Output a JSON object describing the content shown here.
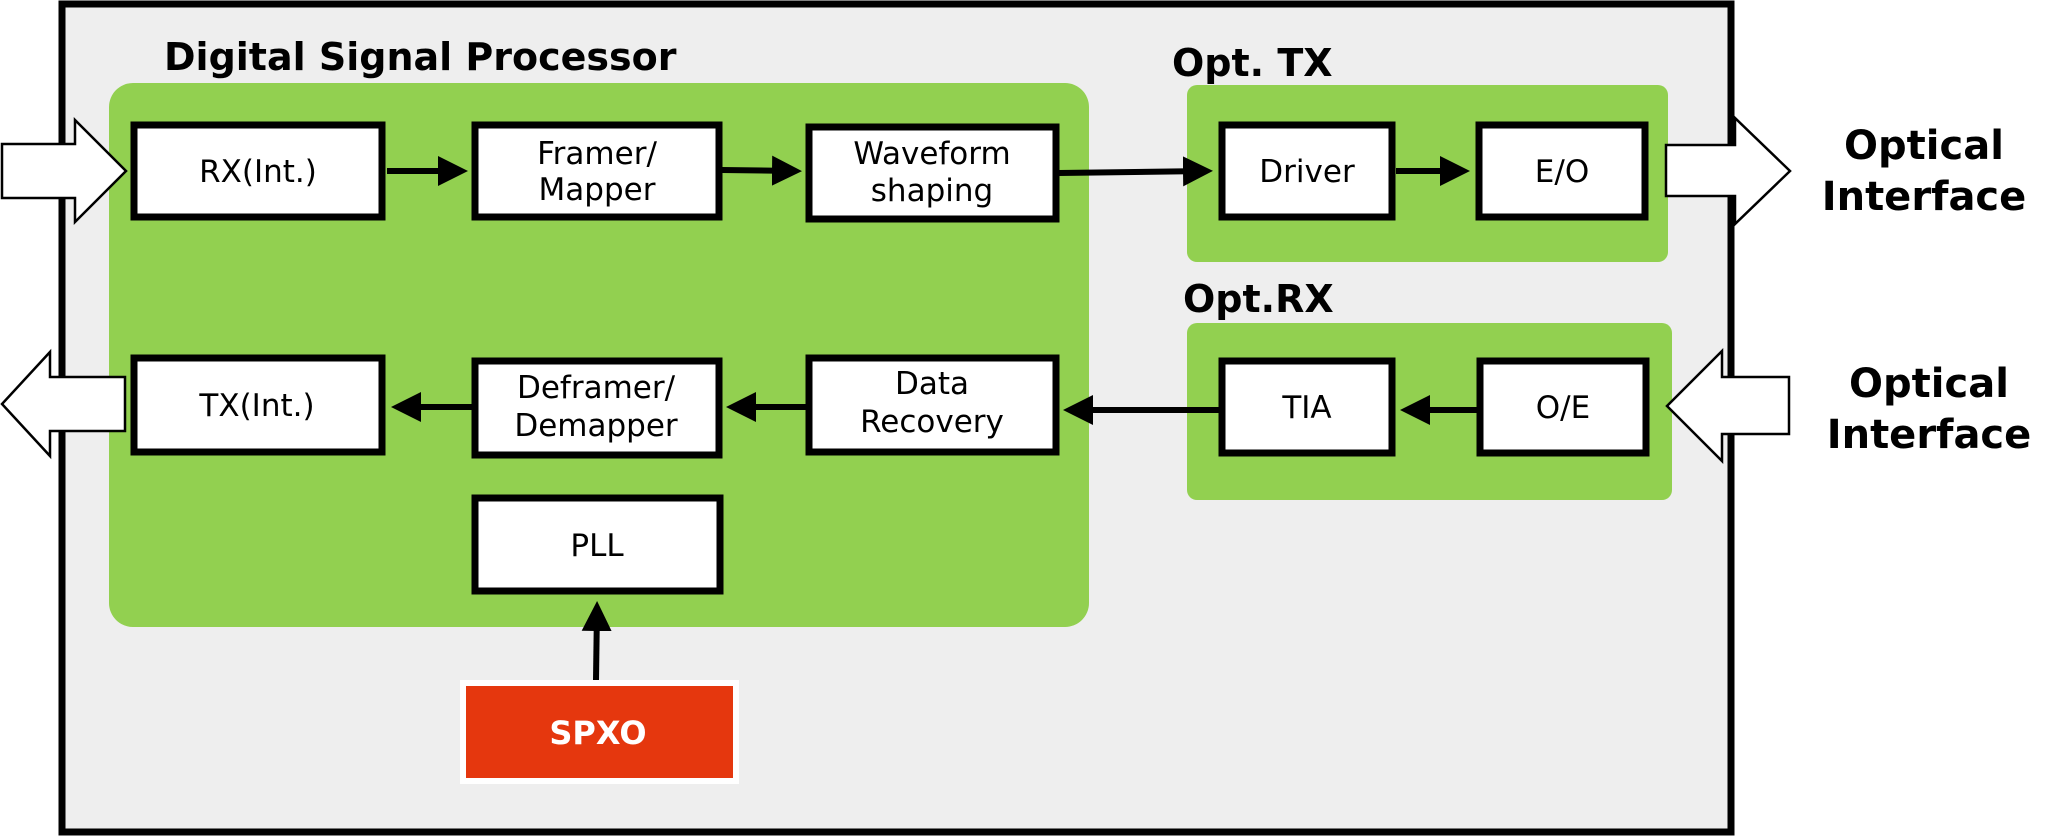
{
  "colors": {
    "background": "#EEEEEE",
    "group_fill": "#92D050",
    "oscillator_fill": "#E5370E",
    "border": "#000000"
  },
  "groups": {
    "dsp": {
      "title": "Digital Signal Processor"
    },
    "opt_tx": {
      "title": "Opt. TX"
    },
    "opt_rx": {
      "title": "Opt.RX"
    }
  },
  "blocks": {
    "rx_int": [
      "RX(Int.)"
    ],
    "framer": [
      "Framer/",
      "Mapper"
    ],
    "waveform": [
      "Waveform",
      "shaping"
    ],
    "tx_int": [
      "TX(Int.)"
    ],
    "deframer": [
      "Deframer/",
      "Demapper"
    ],
    "data_recovery": [
      "Data",
      "Recovery"
    ],
    "pll": [
      "PLL"
    ],
    "driver": [
      "Driver"
    ],
    "eo": [
      "E/O"
    ],
    "tia": [
      "TIA"
    ],
    "oe": [
      "O/E"
    ],
    "spxo": [
      "SPXO"
    ]
  },
  "external": {
    "optical_out": [
      "Optical",
      "Interface"
    ],
    "optical_in": [
      "Optical",
      "Interface"
    ]
  }
}
